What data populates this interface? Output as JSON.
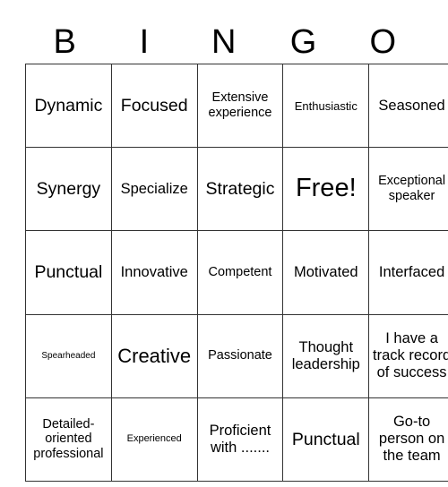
{
  "card": {
    "header_letters": [
      "B",
      "I",
      "N",
      "G",
      "O"
    ],
    "rows": [
      [
        {
          "text": "Dynamic",
          "size": "lg"
        },
        {
          "text": "Focused",
          "size": "lg"
        },
        {
          "text": "Extensive experience",
          "size": "sm"
        },
        {
          "text": "Enthusiastic",
          "size": "xs"
        },
        {
          "text": "Seasoned",
          "size": "md"
        }
      ],
      [
        {
          "text": "Synergy",
          "size": "lg"
        },
        {
          "text": "Specialize",
          "size": "md"
        },
        {
          "text": "Strategic",
          "size": "lg"
        },
        {
          "text": "Free!",
          "size": "xxl"
        },
        {
          "text": "Exceptional speaker",
          "size": "sm"
        }
      ],
      [
        {
          "text": "Punctual",
          "size": "lg"
        },
        {
          "text": "Innovative",
          "size": "md"
        },
        {
          "text": "Competent",
          "size": "sm"
        },
        {
          "text": "Motivated",
          "size": "md"
        },
        {
          "text": "Interfaced",
          "size": "md"
        }
      ],
      [
        {
          "text": "Spearheaded",
          "size": "min"
        },
        {
          "text": "Creative",
          "size": "xl"
        },
        {
          "text": "Passionate",
          "size": "sm"
        },
        {
          "text": "Thought leadership",
          "size": "md"
        },
        {
          "text": "I have a track record of success",
          "size": "md"
        }
      ],
      [
        {
          "text": "Detailed-oriented professional",
          "size": "sm"
        },
        {
          "text": "Experienced",
          "size": "xxs"
        },
        {
          "text": "Proficient with .......",
          "size": "md"
        },
        {
          "text": "Punctual",
          "size": "lg"
        },
        {
          "text": "Go-to person on the team",
          "size": "md"
        }
      ]
    ]
  }
}
